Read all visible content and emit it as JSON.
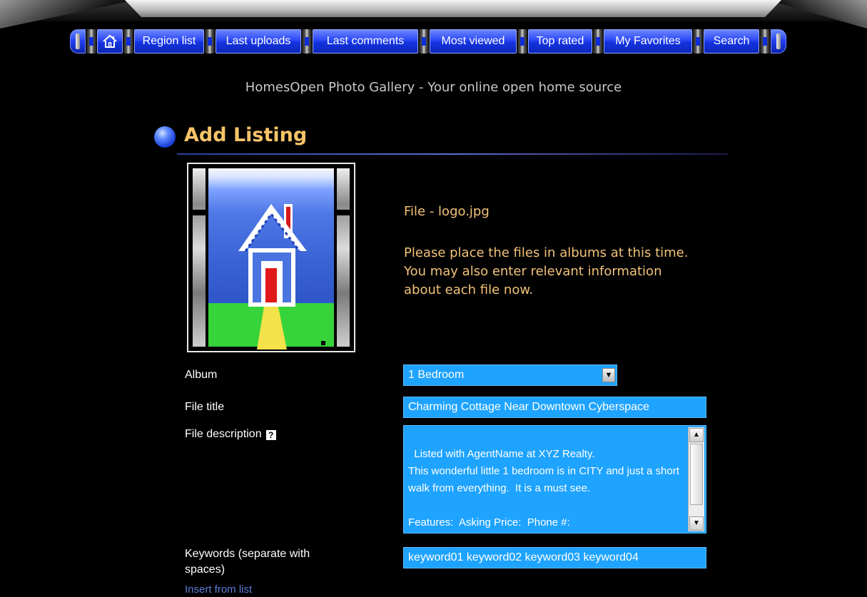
{
  "nav": {
    "home_icon": "home-icon",
    "items": [
      {
        "label": "Region list"
      },
      {
        "label": "Last uploads"
      },
      {
        "label": "Last comments"
      },
      {
        "label": "Most viewed"
      },
      {
        "label": "Top rated"
      },
      {
        "label": "My Favorites"
      },
      {
        "label": "Search"
      }
    ]
  },
  "site": {
    "subtitle": "HomesOpen Photo Gallery - Your online open home source"
  },
  "page": {
    "heading": "Add Listing",
    "file_line": "File - logo.jpg",
    "instructions": "Please place the files in albums at this time.\nYou may also enter relevant information\nabout each file now."
  },
  "form": {
    "album_label": "Album",
    "album_value": "1 Bedroom",
    "title_label": "File title",
    "title_value": "Charming Cottage Near Downtown Cyberspace",
    "description_label": "File description",
    "help_icon": "?",
    "description_value": "Listed with AgentName at XYZ Realty.\nThis wonderful little 1 bedroom is in CITY and just a short walk from everything.  It is a must see.\n\nFeatures:  Asking Price:  Phone #:",
    "keywords_label": "Keywords (separate with\nspaces)",
    "keywords_value": "keyword01 keyword02 keyword03 keyword04",
    "insert_link": "Insert from list"
  },
  "colors": {
    "accent_blue": "#1ea3ff",
    "heading_gold": "#f7c468",
    "nav_blue": "#2b48f5"
  }
}
